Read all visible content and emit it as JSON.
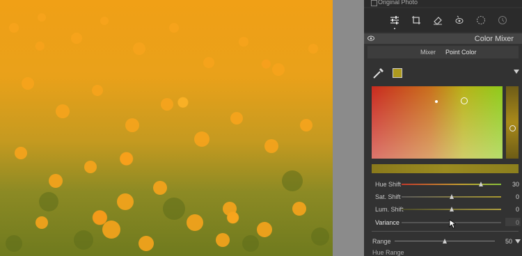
{
  "photo": {
    "alt_colors": {
      "poppy": "#f6a21a",
      "foliage": "#6f7a1e"
    }
  },
  "original_photo": {
    "label": "Original Photo"
  },
  "toolbar": {
    "icons": [
      "sliders-icon",
      "crop-icon",
      "healing-icon",
      "redeye-icon",
      "mask-icon",
      "history-icon"
    ]
  },
  "panel": {
    "title": "Color Mixer",
    "tabs": {
      "mixer": "Mixer",
      "point_color": "Point Color"
    },
    "swatch_color": "#ad9a1e"
  },
  "sliders": [
    {
      "label": "Hue Shift",
      "value": "30",
      "fraction": 0.8
    },
    {
      "label": "Sat. Shift",
      "value": "0",
      "fraction": 0.5
    },
    {
      "label": "Lum. Shift",
      "value": "0",
      "fraction": 0.5
    },
    {
      "label": "Variance",
      "value": "0",
      "fraction": 0.5
    },
    {
      "label": "Range",
      "value": "50",
      "fraction": 0.5
    }
  ],
  "hue_range": {
    "label": "Hue Range"
  }
}
